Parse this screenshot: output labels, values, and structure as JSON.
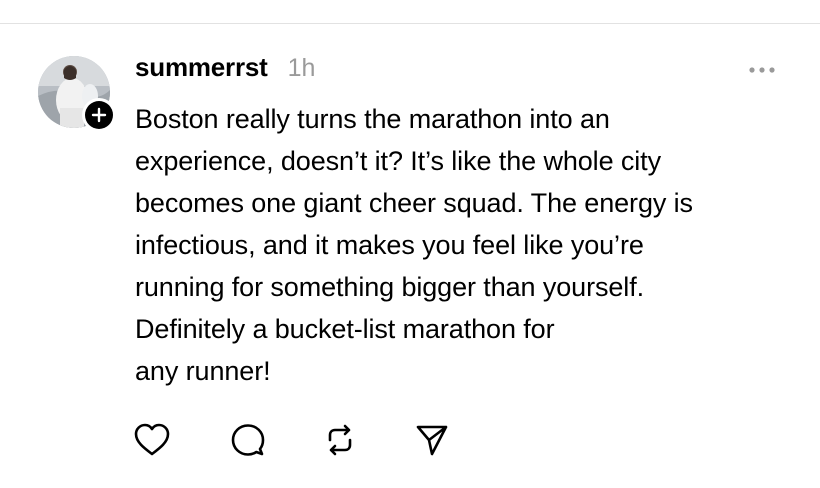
{
  "post": {
    "author": {
      "username": "summerrst",
      "avatar_icon": "profile-photo",
      "follow_icon": "plus-icon"
    },
    "timestamp": "1h",
    "more_icon": "more-horizontal-icon",
    "body_lines": [
      "Boston really turns the marathon into an",
      "experience, doesn’t it? It’s like the whole city",
      "becomes one giant cheer squad. The energy is",
      "infectious, and it makes you feel like you’re",
      "running for something bigger than yourself.",
      "Definitely a bucket-list marathon for",
      "any runner!"
    ],
    "actions": [
      {
        "name": "like",
        "icon": "heart-icon"
      },
      {
        "name": "reply",
        "icon": "comment-icon"
      },
      {
        "name": "repost",
        "icon": "repost-icon"
      },
      {
        "name": "share",
        "icon": "send-icon"
      }
    ]
  },
  "colors": {
    "text": "#000000",
    "muted": "#9a9a9a",
    "divider": "#e2e2e2",
    "background": "#ffffff"
  }
}
